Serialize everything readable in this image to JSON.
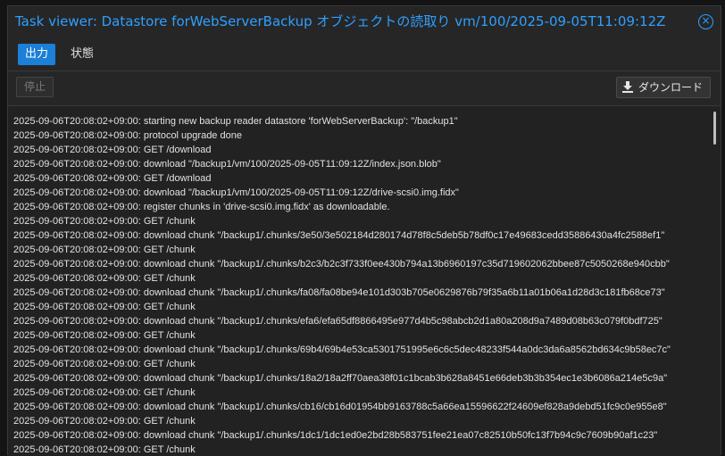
{
  "window": {
    "title": "Task viewer: Datastore forWebServerBackup オブジェクトの読取り vm/100/2025-09-05T11:09:12Z",
    "close_symbol": "×"
  },
  "tabs": [
    {
      "label": "出力",
      "active": true
    },
    {
      "label": "状態",
      "active": false
    }
  ],
  "toolbar": {
    "stop_label": "停止",
    "download_label": "ダウンロード",
    "download_icon": "download-icon"
  },
  "colors": {
    "accent": "#2ea0ff",
    "active_tab": "#1c7fd8"
  },
  "log": {
    "lines": [
      "2025-09-06T20:08:02+09:00: starting new backup reader datastore 'forWebServerBackup': \"/backup1\"",
      "2025-09-06T20:08:02+09:00: protocol upgrade done",
      "2025-09-06T20:08:02+09:00: GET /download",
      "2025-09-06T20:08:02+09:00: download \"/backup1/vm/100/2025-09-05T11:09:12Z/index.json.blob\"",
      "2025-09-06T20:08:02+09:00: GET /download",
      "2025-09-06T20:08:02+09:00: download \"/backup1/vm/100/2025-09-05T11:09:12Z/drive-scsi0.img.fidx\"",
      "2025-09-06T20:08:02+09:00: register chunks in 'drive-scsi0.img.fidx' as downloadable.",
      "2025-09-06T20:08:02+09:00: GET /chunk",
      "2025-09-06T20:08:02+09:00: download chunk \"/backup1/.chunks/3e50/3e502184d280174d78f8c5deb5b78df0c17e49683cedd35886430a4fc2588ef1\"",
      "2025-09-06T20:08:02+09:00: GET /chunk",
      "2025-09-06T20:08:02+09:00: download chunk \"/backup1/.chunks/b2c3/b2c3f733f0ee430b794a13b6960197c35d719602062bbee87c5050268e940cbb\"",
      "2025-09-06T20:08:02+09:00: GET /chunk",
      "2025-09-06T20:08:02+09:00: download chunk \"/backup1/.chunks/fa08/fa08be94e101d303b705e0629876b79f35a6b11a01b06a1d28d3c181fb68ce73\"",
      "2025-09-06T20:08:02+09:00: GET /chunk",
      "2025-09-06T20:08:02+09:00: download chunk \"/backup1/.chunks/efa6/efa65df8866495e977d4b5c98abcb2d1a80a208d9a7489d08b63c079f0bdf725\"",
      "2025-09-06T20:08:02+09:00: GET /chunk",
      "2025-09-06T20:08:02+09:00: download chunk \"/backup1/.chunks/69b4/69b4e53ca5301751995e6c6c5dec48233f544a0dc3da6a8562bd634c9b58ec7c\"",
      "2025-09-06T20:08:02+09:00: GET /chunk",
      "2025-09-06T20:08:02+09:00: download chunk \"/backup1/.chunks/18a2/18a2ff70aea38f01c1bcab3b628a8451e66deb3b3b354ec1e3b6086a214e5c9a\"",
      "2025-09-06T20:08:02+09:00: GET /chunk",
      "2025-09-06T20:08:02+09:00: download chunk \"/backup1/.chunks/cb16/cb16d01954bb9163788c5a66ea15596622f24609ef828a9debd51fc9c0e955e8\"",
      "2025-09-06T20:08:02+09:00: GET /chunk",
      "2025-09-06T20:08:02+09:00: download chunk \"/backup1/.chunks/1dc1/1dc1ed0e2bd28b583751fee21ea07c82510b50fc13f7b94c9c7609b90af1c23\"",
      "2025-09-06T20:08:02+09:00: GET /chunk"
    ]
  }
}
